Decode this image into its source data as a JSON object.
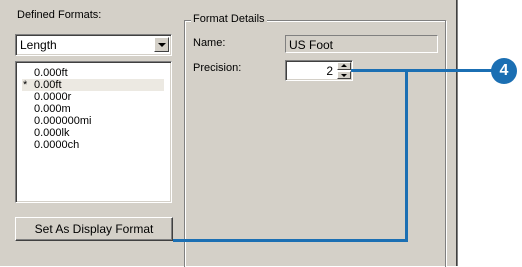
{
  "defined_formats": {
    "label": "Defined Formats:",
    "combo_value": "Length",
    "list_items": [
      {
        "label": "0.000ft",
        "marker": ""
      },
      {
        "label": "0.00ft",
        "marker": "*"
      },
      {
        "label": "0.0000r",
        "marker": ""
      },
      {
        "label": "0.000m",
        "marker": ""
      },
      {
        "label": "0.000000mi",
        "marker": ""
      },
      {
        "label": "0.000lk",
        "marker": ""
      },
      {
        "label": "0.0000ch",
        "marker": ""
      }
    ],
    "set_display_button": "Set As Display Format"
  },
  "format_details": {
    "title": "Format Details",
    "name_label": "Name:",
    "name_value": "US Foot",
    "precision_label": "Precision:",
    "precision_value": "2"
  },
  "callout": {
    "number": "4",
    "color": "#1b6fb3"
  }
}
